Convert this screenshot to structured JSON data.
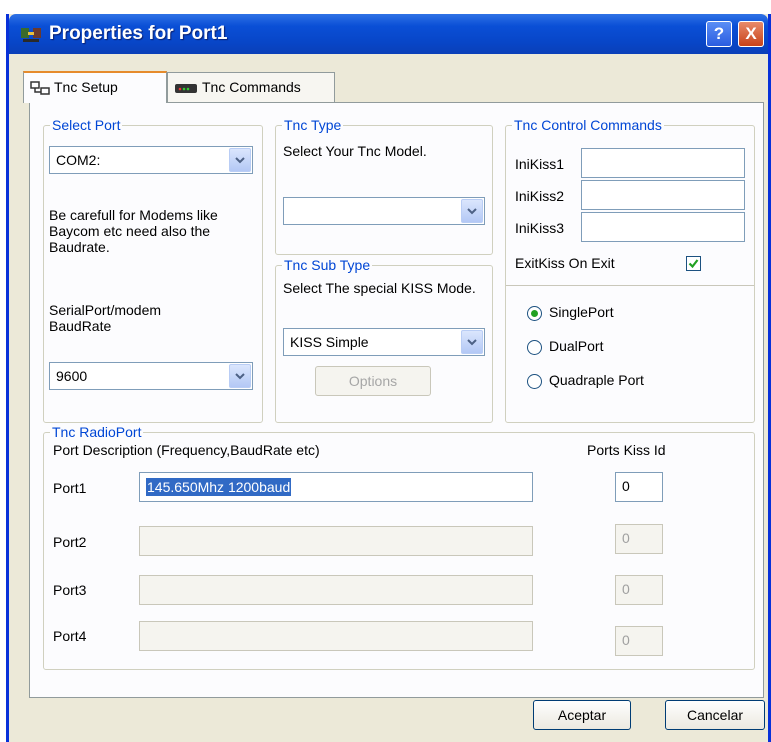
{
  "window": {
    "title": "Properties for Port1",
    "help_glyph": "?",
    "close_glyph": "X"
  },
  "tabs": [
    {
      "label": "Tnc Setup"
    },
    {
      "label": "Tnc Commands"
    }
  ],
  "select_port": {
    "legend": "Select Port",
    "port_value": "COM2:",
    "warning": "Be carefull for Modems like Baycom etc need also the Baudrate.",
    "baud_label": "SerialPort/modem BaudRate",
    "baud_value": "9600"
  },
  "tnc_type": {
    "legend": "Tnc Type",
    "prompt": "Select Your Tnc Model.",
    "value": ""
  },
  "tnc_sub_type": {
    "legend": "Tnc Sub Type",
    "prompt": "Select The special KISS Mode.",
    "value": "KISS Simple",
    "options_label": "Options"
  },
  "control": {
    "legend": "Tnc Control Commands",
    "fields": [
      {
        "label": "IniKiss1",
        "value": ""
      },
      {
        "label": "IniKiss2",
        "value": ""
      },
      {
        "label": "IniKiss3",
        "value": ""
      }
    ],
    "exit_label": "ExitKiss On Exit",
    "exit_checked": true,
    "modes": [
      {
        "label": "SinglePort",
        "selected": true
      },
      {
        "label": "DualPort",
        "selected": false
      },
      {
        "label": "Quadraple Port",
        "selected": false
      }
    ]
  },
  "radio_port": {
    "legend": "Tnc RadioPort",
    "desc_header": "Port Description (Frequency,BaudRate etc)",
    "kiss_header": "Ports Kiss Id",
    "ports": [
      {
        "label": "Port1",
        "desc": "145.650Mhz 1200baud",
        "kiss_id": "0"
      },
      {
        "label": "Port2",
        "desc": "",
        "kiss_id": "0"
      },
      {
        "label": "Port3",
        "desc": "",
        "kiss_id": "0"
      },
      {
        "label": "Port4",
        "desc": "",
        "kiss_id": "0"
      }
    ]
  },
  "buttons": {
    "ok": "Aceptar",
    "cancel": "Cancelar"
  },
  "colors": {
    "accent": "#0046d5",
    "titlebar": "#0a4fd6",
    "check": "#21a121"
  }
}
